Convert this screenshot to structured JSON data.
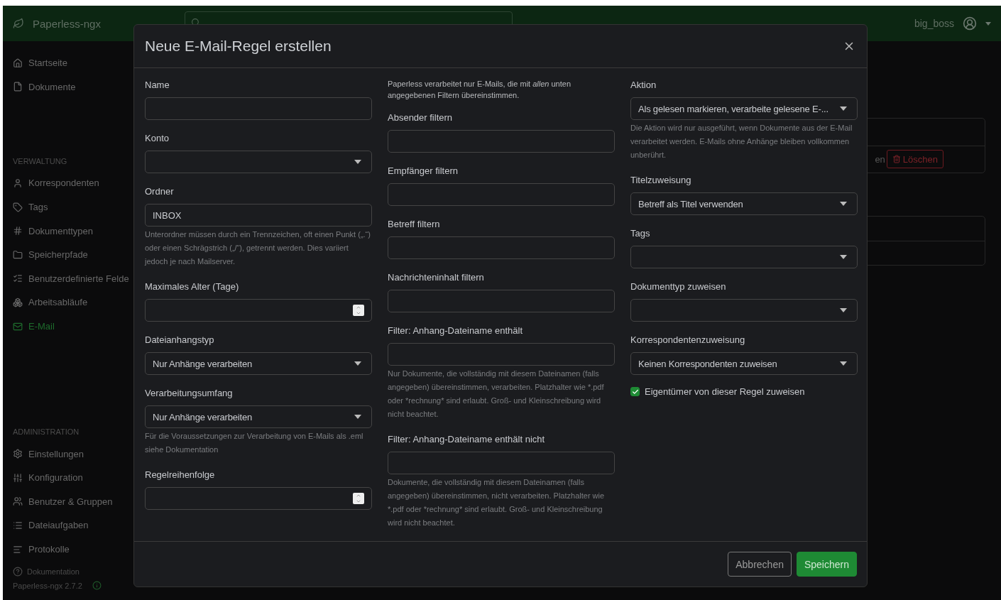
{
  "app": {
    "brand": "Paperless-ngx",
    "user": "big_boss"
  },
  "sidebar": {
    "top_items": [
      {
        "label": "Startseite",
        "selected": false
      },
      {
        "label": "Dokumente",
        "selected": false
      }
    ],
    "sections": [
      {
        "title": "VERWALTUNG",
        "items": [
          {
            "label": "Korrespondenten",
            "selected": false
          },
          {
            "label": "Tags",
            "selected": false
          },
          {
            "label": "Dokumenttypen",
            "selected": false
          },
          {
            "label": "Speicherpfade",
            "selected": false
          },
          {
            "label": "Benutzerdefinierte Felde",
            "selected": false
          },
          {
            "label": "Arbeitsabläufe",
            "selected": false
          },
          {
            "label": "E-Mail",
            "selected": true
          }
        ]
      },
      {
        "title": "ADMINISTRATION",
        "items": [
          {
            "label": "Einstellungen",
            "selected": false
          },
          {
            "label": "Konfiguration",
            "selected": false
          },
          {
            "label": "Benutzer & Gruppen",
            "selected": false
          },
          {
            "label": "Dateiaufgaben",
            "selected": false
          },
          {
            "label": "Protokolle",
            "selected": false
          }
        ]
      }
    ],
    "documentation": "Dokumentation",
    "version": "Paperless-ngx 2.7.2"
  },
  "background": {
    "partial_text": "en",
    "delete_button": "Löschen"
  },
  "modal": {
    "title": "Neue E-Mail-Regel erstellen",
    "columns": [
      [
        {
          "kind": "text",
          "label": "Name"
        },
        {
          "kind": "select",
          "label": "Konto"
        },
        {
          "kind": "text",
          "label": "Ordner",
          "value": "INBOX",
          "help": "Unterordner müssen durch ein Trennzeichen, oft einen Punkt („.“) oder einen Schrägstrich („/“), getrennt werden. Dies variiert jedoch je nach Mailserver."
        },
        {
          "kind": "number",
          "label": "Maximales Alter (Tage)"
        },
        {
          "kind": "select",
          "label": "Dateianhangstyp",
          "value": "Nur Anhänge verarbeiten"
        },
        {
          "kind": "select",
          "label": "Verarbeitungsumfang",
          "value": "Nur Anhänge verarbeiten",
          "help": "Für die Voraussetzungen zur Verarbeitung von E-Mails als .eml siehe Dokumentation"
        },
        {
          "kind": "number",
          "label": "Regelreihenfolge"
        }
      ],
      [
        {
          "kind": "note",
          "text": "Paperless verarbeitet nur E-Mails, die mit *allen* unten angegebenen Filtern übereinstimmen."
        },
        {
          "kind": "text",
          "label": "Absender filtern"
        },
        {
          "kind": "text",
          "label": "Empfänger filtern"
        },
        {
          "kind": "text",
          "label": "Betreff filtern"
        },
        {
          "kind": "text",
          "label": "Nachrichteninhalt filtern"
        },
        {
          "kind": "text",
          "label": "Filter: Anhang-Dateiname enthält",
          "help": "Nur Dokumente, die vollständig mit diesem Dateinamen (falls angegeben) übereinstimmen, verarbeiten. Platzhalter wie *.pdf oder *rechnung* sind erlaubt. Groß- und Kleinschreibung wird nicht beachtet."
        },
        {
          "kind": "text",
          "label": "Filter: Anhang-Dateiname enthält nicht",
          "help": "Dokumente, die vollständig mit diesem Dateinamen (falls angegeben) übereinstimmen, nicht verarbeiten. Platzhalter wie *.pdf oder *rechnung* sind erlaubt. Groß- und Kleinschreibung wird nicht beachtet."
        }
      ],
      [
        {
          "kind": "select",
          "label": "Aktion",
          "value": "Als gelesen markieren, verarbeite gelesene E-...",
          "help": "Die Aktion wird nur ausgeführt, wenn Dokumente aus der E-Mail verarbeitet werden. E-Mails ohne Anhänge bleiben vollkommen unberührt."
        },
        {
          "kind": "select",
          "label": "Titelzuweisung",
          "value": "Betreff als Titel verwenden"
        },
        {
          "kind": "select",
          "label": "Tags"
        },
        {
          "kind": "select",
          "label": "Dokumenttyp zuweisen"
        },
        {
          "kind": "select",
          "label": "Korrespondentenzuweisung",
          "value": "Keinen Korrespondenten zuweisen"
        },
        {
          "kind": "checkbox",
          "label": "Eigentümer von dieser Regel zuweisen",
          "checked": true
        }
      ]
    ],
    "buttons": [
      {
        "kind": "secondary",
        "label": "Abbrechen"
      },
      {
        "kind": "primary",
        "label": "Speichern"
      }
    ]
  }
}
